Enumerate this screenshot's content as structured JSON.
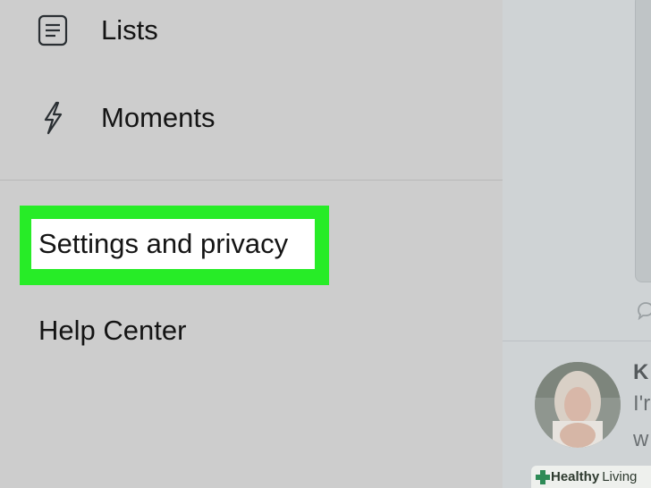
{
  "menu": {
    "items": [
      {
        "label": "Lists",
        "icon": "list-icon"
      },
      {
        "label": "Moments",
        "icon": "lightning-icon"
      }
    ],
    "settings_label": "Settings and privacy",
    "help_label": "Help Center"
  },
  "timeline": {
    "tweet": {
      "name_fragment": "K",
      "line1_fragment": "I'r",
      "line2_fragment": "w"
    }
  },
  "watermark": {
    "brand": "Healthy",
    "suffix": "Living"
  },
  "colors": {
    "highlight": "#27ec27",
    "drawer_bg": "#cdcdcd",
    "text": "#141414"
  }
}
